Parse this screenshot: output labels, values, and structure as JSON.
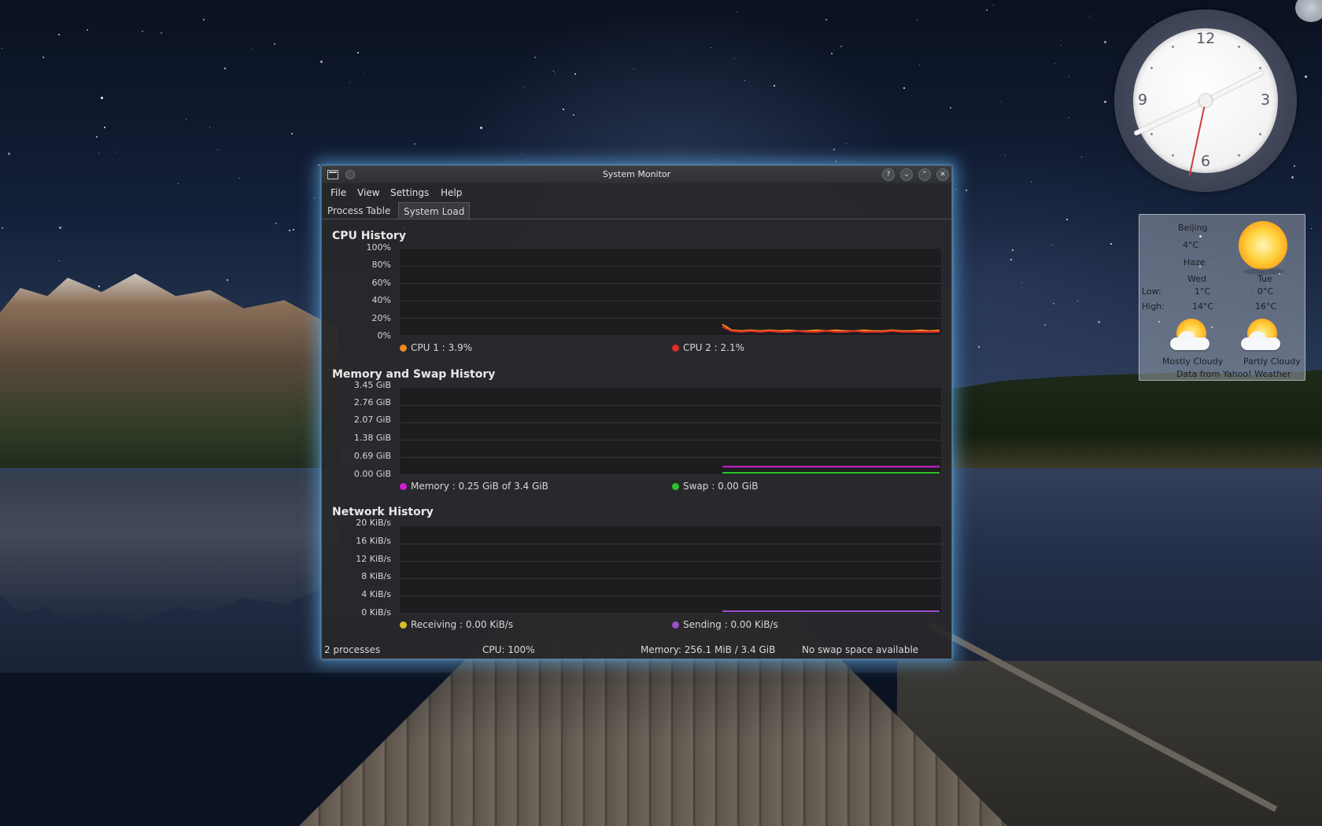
{
  "clock": {
    "numbers": {
      "twelve": "12",
      "three": "3",
      "six": "6",
      "nine": "9"
    },
    "time": {
      "hour": 8,
      "minute": 10,
      "second": 32
    }
  },
  "weather": {
    "city": "Beijing",
    "temperature": "4°C",
    "condition": "Haze",
    "days": [
      {
        "day": "Wed",
        "low": "1°C",
        "high": "14°C",
        "condition": "Mostly Cloudy",
        "icon": "cloud-sun-icon"
      },
      {
        "day": "Tue",
        "low": "0°C",
        "high": "16°C",
        "condition": "Partly Cloudy",
        "icon": "cloud-sun-icon"
      }
    ],
    "low_label": "Low:",
    "high_label": "High:",
    "source": "Data from Yahoo! Weather",
    "current_icon": "sun-icon"
  },
  "window": {
    "title": "System Monitor",
    "titlebar_buttons": [
      "help-icon",
      "minimize-icon",
      "maximize-icon",
      "close-icon"
    ],
    "menu": [
      "File",
      "View",
      "Settings",
      "Help"
    ],
    "tabs": [
      {
        "label": "Process Table",
        "active": false
      },
      {
        "label": "System Load",
        "active": true
      }
    ]
  },
  "cpu": {
    "title": "CPU History",
    "ticks": [
      "100%",
      "80%",
      "60%",
      "40%",
      "20%",
      "0%"
    ],
    "legend": [
      {
        "label": "CPU 1 : 3.9%",
        "color": "#f28a1e"
      },
      {
        "label": "CPU 2 : 2.1%",
        "color": "#e22a2a"
      }
    ]
  },
  "memory": {
    "title": "Memory and Swap History",
    "ticks": [
      "3.45 GiB",
      "2.76 GiB",
      "2.07 GiB",
      "1.38 GiB",
      "0.69 GiB",
      "0.00 GiB"
    ],
    "legend": [
      {
        "label": "Memory : 0.25 GiB of 3.4 GiB",
        "color": "#d21fd2"
      },
      {
        "label": "Swap : 0.00 GiB",
        "color": "#2ac42a"
      }
    ]
  },
  "network": {
    "title": "Network History",
    "ticks": [
      "20 KiB/s",
      "16 KiB/s",
      "12 KiB/s",
      "8 KiB/s",
      "4 KiB/s",
      "0 KiB/s"
    ],
    "legend": [
      {
        "label": "Receiving : 0.00 KiB/s",
        "color": "#d8c22a"
      },
      {
        "label": "Sending : 0.00 KiB/s",
        "color": "#9b4fd0"
      }
    ]
  },
  "status": {
    "processes": "2 processes",
    "cpu": "CPU: 100%",
    "memory": "Memory: 256.1 MiB / 3.4 GiB",
    "swap": "No swap space available"
  },
  "chart_data": [
    {
      "type": "line",
      "title": "CPU History",
      "ylim": [
        0,
        100
      ],
      "series": [
        {
          "name": "CPU 1",
          "color": "#f28a1e",
          "values": [
            11,
            4,
            3,
            4,
            3,
            4,
            3,
            4,
            3,
            3,
            4,
            3,
            4,
            3,
            3,
            4,
            3,
            3,
            4,
            3,
            3,
            4,
            3,
            3.9
          ]
        },
        {
          "name": "CPU 2",
          "color": "#e22a2a",
          "values": [
            8,
            3,
            2,
            3,
            2,
            3,
            2,
            2,
            3,
            2,
            2,
            3,
            2,
            2,
            3,
            2,
            2,
            2,
            3,
            2,
            2,
            2,
            2,
            2.1
          ]
        }
      ]
    },
    {
      "type": "line",
      "title": "Memory and Swap History",
      "ylim": [
        0,
        3.45
      ],
      "series": [
        {
          "name": "Memory",
          "color": "#d21fd2",
          "values": [
            0.25,
            0.25
          ]
        },
        {
          "name": "Swap",
          "color": "#2ac42a",
          "values": [
            0.0,
            0.0
          ]
        }
      ]
    },
    {
      "type": "line",
      "title": "Network History",
      "ylim": [
        0,
        20
      ],
      "series": [
        {
          "name": "Receiving",
          "color": "#d8c22a",
          "values": [
            0.0,
            0.0
          ]
        },
        {
          "name": "Sending",
          "color": "#9b4fd0",
          "values": [
            0.0,
            0.0
          ]
        }
      ]
    }
  ]
}
